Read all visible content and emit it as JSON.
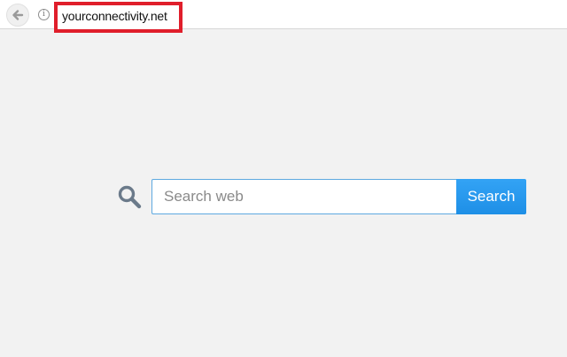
{
  "browser": {
    "url": "yourconnectivity.net",
    "back_icon": "arrow-left-icon",
    "info_icon_glyph": "i",
    "highlight_color": "#e01e2b"
  },
  "search": {
    "placeholder": "Search web",
    "value": "",
    "button_label": "Search",
    "button_color": "#2196f3",
    "icon": "magnifier-icon"
  }
}
